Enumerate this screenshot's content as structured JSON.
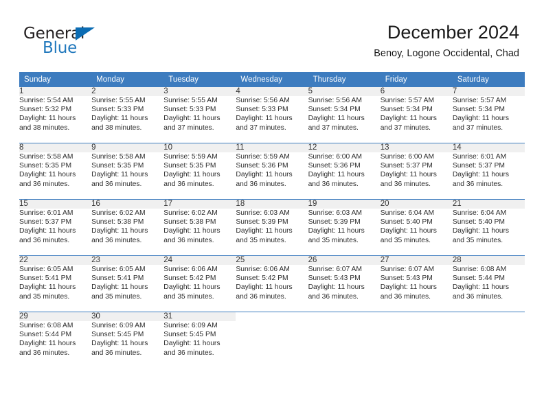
{
  "brand": {
    "word1": "General",
    "word2": "Blue",
    "logo_icon": "blue-triangle-logo"
  },
  "header": {
    "title": "December 2024",
    "subtitle": "Benoy, Logone Occidental, Chad"
  },
  "colors": {
    "header_blue": "#3d7cbf",
    "brand_blue": "#2279bd",
    "daynum_band": "#f0f0f0",
    "text": "#2b2b2b"
  },
  "weekday_headers": [
    "Sunday",
    "Monday",
    "Tuesday",
    "Wednesday",
    "Thursday",
    "Friday",
    "Saturday"
  ],
  "weeks": [
    [
      {
        "day": "1",
        "sunrise": "Sunrise: 5:54 AM",
        "sunset": "Sunset: 5:32 PM",
        "daylight1": "Daylight: 11 hours",
        "daylight2": "and 38 minutes."
      },
      {
        "day": "2",
        "sunrise": "Sunrise: 5:55 AM",
        "sunset": "Sunset: 5:33 PM",
        "daylight1": "Daylight: 11 hours",
        "daylight2": "and 38 minutes."
      },
      {
        "day": "3",
        "sunrise": "Sunrise: 5:55 AM",
        "sunset": "Sunset: 5:33 PM",
        "daylight1": "Daylight: 11 hours",
        "daylight2": "and 37 minutes."
      },
      {
        "day": "4",
        "sunrise": "Sunrise: 5:56 AM",
        "sunset": "Sunset: 5:33 PM",
        "daylight1": "Daylight: 11 hours",
        "daylight2": "and 37 minutes."
      },
      {
        "day": "5",
        "sunrise": "Sunrise: 5:56 AM",
        "sunset": "Sunset: 5:34 PM",
        "daylight1": "Daylight: 11 hours",
        "daylight2": "and 37 minutes."
      },
      {
        "day": "6",
        "sunrise": "Sunrise: 5:57 AM",
        "sunset": "Sunset: 5:34 PM",
        "daylight1": "Daylight: 11 hours",
        "daylight2": "and 37 minutes."
      },
      {
        "day": "7",
        "sunrise": "Sunrise: 5:57 AM",
        "sunset": "Sunset: 5:34 PM",
        "daylight1": "Daylight: 11 hours",
        "daylight2": "and 37 minutes."
      }
    ],
    [
      {
        "day": "8",
        "sunrise": "Sunrise: 5:58 AM",
        "sunset": "Sunset: 5:35 PM",
        "daylight1": "Daylight: 11 hours",
        "daylight2": "and 36 minutes."
      },
      {
        "day": "9",
        "sunrise": "Sunrise: 5:58 AM",
        "sunset": "Sunset: 5:35 PM",
        "daylight1": "Daylight: 11 hours",
        "daylight2": "and 36 minutes."
      },
      {
        "day": "10",
        "sunrise": "Sunrise: 5:59 AM",
        "sunset": "Sunset: 5:35 PM",
        "daylight1": "Daylight: 11 hours",
        "daylight2": "and 36 minutes."
      },
      {
        "day": "11",
        "sunrise": "Sunrise: 5:59 AM",
        "sunset": "Sunset: 5:36 PM",
        "daylight1": "Daylight: 11 hours",
        "daylight2": "and 36 minutes."
      },
      {
        "day": "12",
        "sunrise": "Sunrise: 6:00 AM",
        "sunset": "Sunset: 5:36 PM",
        "daylight1": "Daylight: 11 hours",
        "daylight2": "and 36 minutes."
      },
      {
        "day": "13",
        "sunrise": "Sunrise: 6:00 AM",
        "sunset": "Sunset: 5:37 PM",
        "daylight1": "Daylight: 11 hours",
        "daylight2": "and 36 minutes."
      },
      {
        "day": "14",
        "sunrise": "Sunrise: 6:01 AM",
        "sunset": "Sunset: 5:37 PM",
        "daylight1": "Daylight: 11 hours",
        "daylight2": "and 36 minutes."
      }
    ],
    [
      {
        "day": "15",
        "sunrise": "Sunrise: 6:01 AM",
        "sunset": "Sunset: 5:37 PM",
        "daylight1": "Daylight: 11 hours",
        "daylight2": "and 36 minutes."
      },
      {
        "day": "16",
        "sunrise": "Sunrise: 6:02 AM",
        "sunset": "Sunset: 5:38 PM",
        "daylight1": "Daylight: 11 hours",
        "daylight2": "and 36 minutes."
      },
      {
        "day": "17",
        "sunrise": "Sunrise: 6:02 AM",
        "sunset": "Sunset: 5:38 PM",
        "daylight1": "Daylight: 11 hours",
        "daylight2": "and 36 minutes."
      },
      {
        "day": "18",
        "sunrise": "Sunrise: 6:03 AM",
        "sunset": "Sunset: 5:39 PM",
        "daylight1": "Daylight: 11 hours",
        "daylight2": "and 35 minutes."
      },
      {
        "day": "19",
        "sunrise": "Sunrise: 6:03 AM",
        "sunset": "Sunset: 5:39 PM",
        "daylight1": "Daylight: 11 hours",
        "daylight2": "and 35 minutes."
      },
      {
        "day": "20",
        "sunrise": "Sunrise: 6:04 AM",
        "sunset": "Sunset: 5:40 PM",
        "daylight1": "Daylight: 11 hours",
        "daylight2": "and 35 minutes."
      },
      {
        "day": "21",
        "sunrise": "Sunrise: 6:04 AM",
        "sunset": "Sunset: 5:40 PM",
        "daylight1": "Daylight: 11 hours",
        "daylight2": "and 35 minutes."
      }
    ],
    [
      {
        "day": "22",
        "sunrise": "Sunrise: 6:05 AM",
        "sunset": "Sunset: 5:41 PM",
        "daylight1": "Daylight: 11 hours",
        "daylight2": "and 35 minutes."
      },
      {
        "day": "23",
        "sunrise": "Sunrise: 6:05 AM",
        "sunset": "Sunset: 5:41 PM",
        "daylight1": "Daylight: 11 hours",
        "daylight2": "and 35 minutes."
      },
      {
        "day": "24",
        "sunrise": "Sunrise: 6:06 AM",
        "sunset": "Sunset: 5:42 PM",
        "daylight1": "Daylight: 11 hours",
        "daylight2": "and 35 minutes."
      },
      {
        "day": "25",
        "sunrise": "Sunrise: 6:06 AM",
        "sunset": "Sunset: 5:42 PM",
        "daylight1": "Daylight: 11 hours",
        "daylight2": "and 36 minutes."
      },
      {
        "day": "26",
        "sunrise": "Sunrise: 6:07 AM",
        "sunset": "Sunset: 5:43 PM",
        "daylight1": "Daylight: 11 hours",
        "daylight2": "and 36 minutes."
      },
      {
        "day": "27",
        "sunrise": "Sunrise: 6:07 AM",
        "sunset": "Sunset: 5:43 PM",
        "daylight1": "Daylight: 11 hours",
        "daylight2": "and 36 minutes."
      },
      {
        "day": "28",
        "sunrise": "Sunrise: 6:08 AM",
        "sunset": "Sunset: 5:44 PM",
        "daylight1": "Daylight: 11 hours",
        "daylight2": "and 36 minutes."
      }
    ],
    [
      {
        "day": "29",
        "sunrise": "Sunrise: 6:08 AM",
        "sunset": "Sunset: 5:44 PM",
        "daylight1": "Daylight: 11 hours",
        "daylight2": "and 36 minutes."
      },
      {
        "day": "30",
        "sunrise": "Sunrise: 6:09 AM",
        "sunset": "Sunset: 5:45 PM",
        "daylight1": "Daylight: 11 hours",
        "daylight2": "and 36 minutes."
      },
      {
        "day": "31",
        "sunrise": "Sunrise: 6:09 AM",
        "sunset": "Sunset: 5:45 PM",
        "daylight1": "Daylight: 11 hours",
        "daylight2": "and 36 minutes."
      },
      {
        "day": "",
        "sunrise": "",
        "sunset": "",
        "daylight1": "",
        "daylight2": ""
      },
      {
        "day": "",
        "sunrise": "",
        "sunset": "",
        "daylight1": "",
        "daylight2": ""
      },
      {
        "day": "",
        "sunrise": "",
        "sunset": "",
        "daylight1": "",
        "daylight2": ""
      },
      {
        "day": "",
        "sunrise": "",
        "sunset": "",
        "daylight1": "",
        "daylight2": ""
      }
    ]
  ]
}
